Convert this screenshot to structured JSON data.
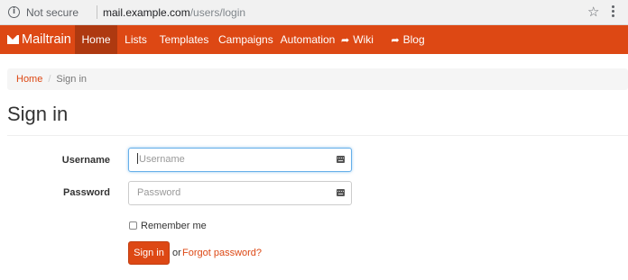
{
  "browser": {
    "security_label": "Not secure",
    "url_host": "mail.example.com",
    "url_path": "/users/login",
    "info_icon": "info-icon",
    "star_icon": "star-icon",
    "menu_icon": "kebab-menu-icon"
  },
  "navbar": {
    "brand": "Mailtrain",
    "brand_icon": "envelope-icon",
    "accent_color": "#dd4814",
    "active_color": "#ae3910",
    "items": [
      {
        "label": "Home",
        "active": true
      },
      {
        "label": "Lists"
      },
      {
        "label": "Templates"
      },
      {
        "label": "Campaigns"
      },
      {
        "label": "Automation"
      },
      {
        "label": "Wiki",
        "icon": "external-link-icon"
      },
      {
        "label": "Blog",
        "icon": "external-link-icon"
      }
    ]
  },
  "breadcrumb": {
    "home": "Home",
    "separator": "/",
    "current": "Sign in"
  },
  "page": {
    "title": "Sign in"
  },
  "form": {
    "username_label": "Username",
    "username_placeholder": "Username",
    "username_value": "",
    "password_label": "Password",
    "password_placeholder": "Password",
    "password_value": "",
    "remember_label": "Remember me",
    "remember_checked": false,
    "submit_label": "Sign in",
    "or_text": "or",
    "forgot_label": "Forgot password?"
  }
}
